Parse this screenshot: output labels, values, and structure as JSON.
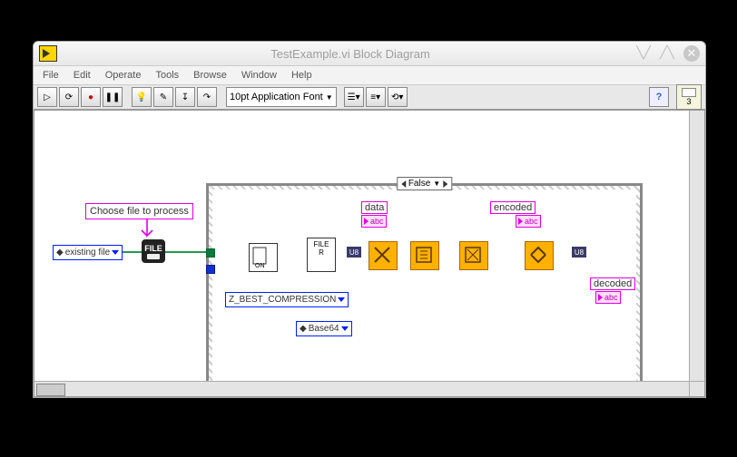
{
  "window": {
    "title": "TestExample.vi Block Diagram"
  },
  "menu": {
    "items": [
      "File",
      "Edit",
      "Operate",
      "Tools",
      "Browse",
      "Window",
      "Help"
    ]
  },
  "toolbar": {
    "font_selector": "10pt Application Font",
    "context_help_number": "3"
  },
  "diagram": {
    "comment_label": "Choose file to process",
    "existing_file_const": "existing file",
    "case_selector": "False",
    "data_label": "data",
    "encoded_label": "encoded",
    "decoded_label": "decoded",
    "compression_const": "Z_BEST_COMPRESSION",
    "base64_const": "Base64",
    "file_dialog_text": "FILE",
    "read_node_text": "FILE\nR",
    "indicator_glyph": "abc"
  }
}
